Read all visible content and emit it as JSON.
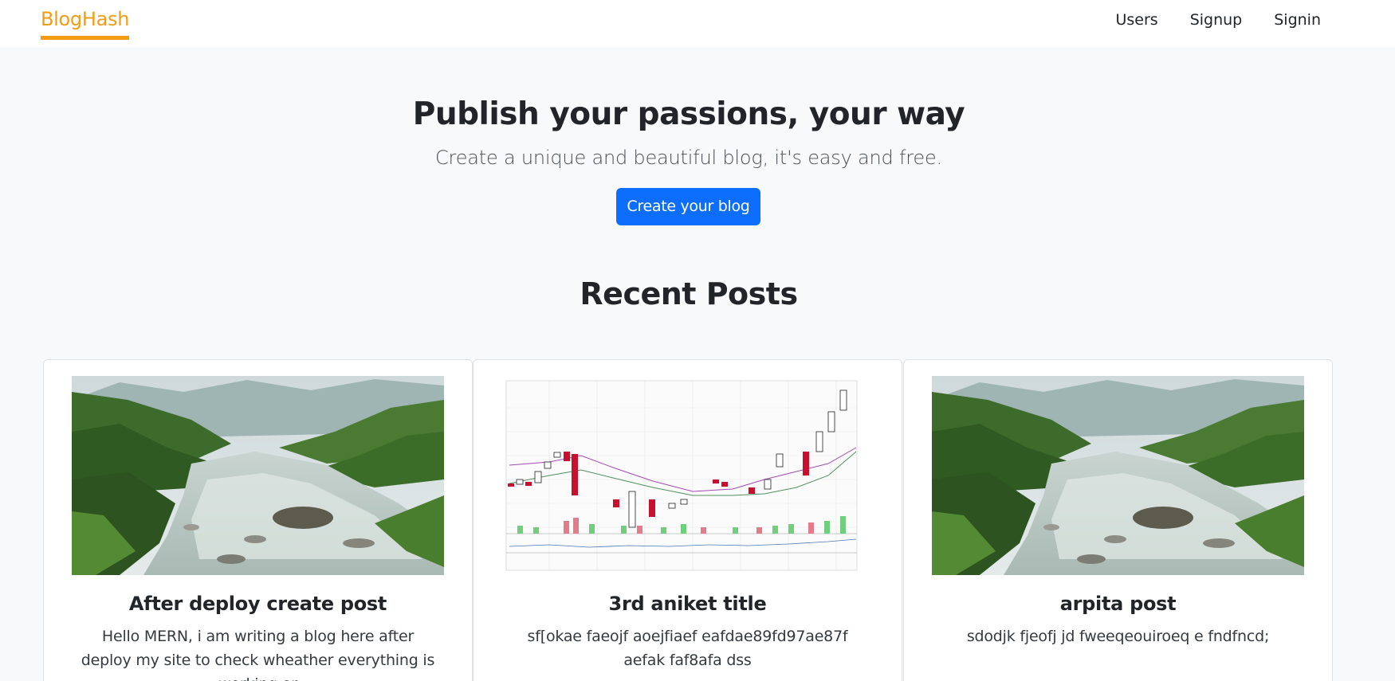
{
  "navbar": {
    "brand": "BlogHash",
    "links": [
      "Users",
      "Signup",
      "Signin"
    ]
  },
  "hero": {
    "title": "Publish your passions, your way",
    "subtitle": "Create a unique and beautiful blog, it's easy and free.",
    "cta_label": "Create your blog"
  },
  "recent": {
    "heading": "Recent Posts",
    "posts": [
      {
        "title": "After deploy create post",
        "excerpt": "Hello MERN, i am writing a blog here after deploy my site to check wheather everything is working or",
        "image": "river-landscape-photo"
      },
      {
        "title": "3rd aniket title",
        "excerpt": "sf[okae faeojf aoejfiaef eafdae89fd97ae87f aefak faf8afa dss",
        "image": "stock-candlestick-chart-image"
      },
      {
        "title": "arpita post",
        "excerpt": "sdodjk fjeofj jd fweeqeouiroeq e fndfncd;",
        "image": "river-landscape-photo"
      }
    ]
  },
  "colors": {
    "brand": "#f39c12",
    "primary": "#0d6efd",
    "page_bg": "#f8f9fa"
  }
}
